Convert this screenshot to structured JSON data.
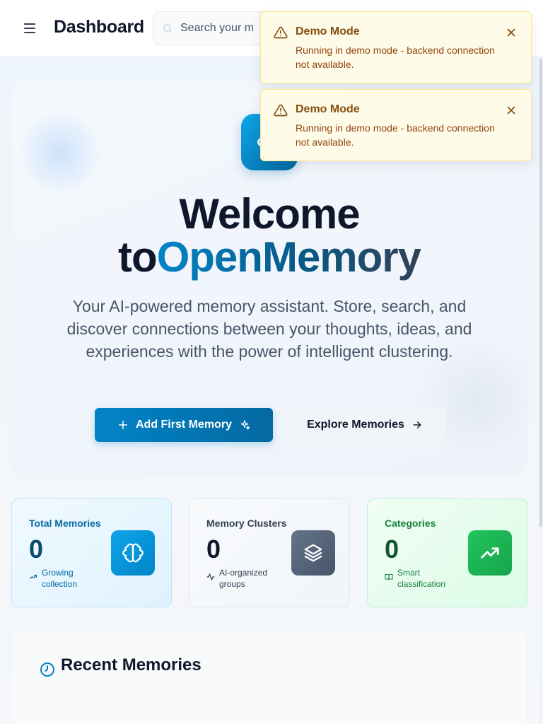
{
  "header": {
    "title": "Dashboard",
    "search_placeholder": "Search your m"
  },
  "hero": {
    "title_line1": "Welcome",
    "title_to": "to",
    "title_brand": "OpenMemory",
    "subtitle": "Your AI-powered memory assistant. Store, search, and discover connections between your thoughts, ideas, and experiences with the power of intelligent clustering.",
    "primary_button": "Add First Memory",
    "secondary_button": "Explore Memories"
  },
  "stats": [
    {
      "label": "Total Memories",
      "value": "0",
      "note": "Growing collection",
      "icon": "brain-icon",
      "color": "#0284c7"
    },
    {
      "label": "Memory Clusters",
      "value": "0",
      "note": "AI-organized groups",
      "icon": "layers-icon",
      "color": "#475569"
    },
    {
      "label": "Categories",
      "value": "0",
      "note": "Smart classification",
      "icon": "trending-up-icon",
      "color": "#16a34a"
    }
  ],
  "recent": {
    "title": "Recent Memories"
  },
  "toasts": [
    {
      "title": "Demo Mode",
      "body": "Running in demo mode - backend connection not available."
    },
    {
      "title": "Demo Mode",
      "body": "Running in demo mode - backend connection not available."
    }
  ],
  "colors": {
    "accent": "#0284c7",
    "toast_bg": "#fefce8",
    "toast_text": "#854d0e"
  }
}
